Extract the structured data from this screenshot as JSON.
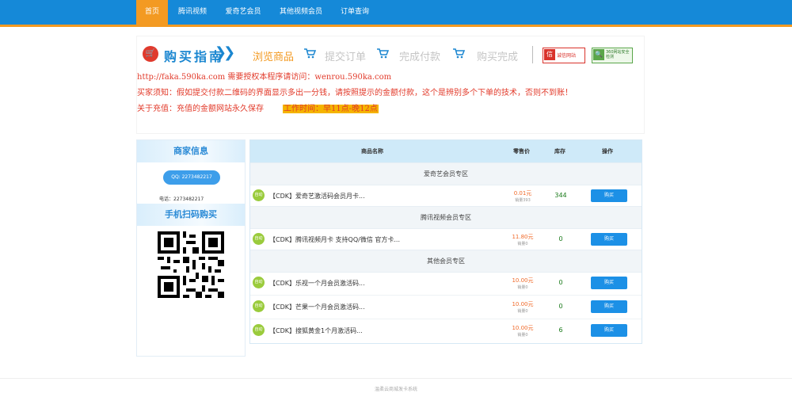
{
  "nav": {
    "items": [
      {
        "label": "首页",
        "active": true
      },
      {
        "label": "腾讯视频",
        "active": false
      },
      {
        "label": "爱奇艺会员",
        "active": false
      },
      {
        "label": "其他视频会员",
        "active": false
      },
      {
        "label": "订单查询",
        "active": false
      }
    ],
    "colors": {
      "bar": "#1589d8",
      "accent": "#f39a22"
    }
  },
  "guide": {
    "title": "购买指南",
    "steps": [
      "浏览商品",
      "提交订单",
      "完成付款",
      "购买完成"
    ],
    "badge_trust": "诚信网站",
    "badge_safe": "360网站安全检测",
    "lines": [
      "http://faka.590ka.com  需要授权本程序请访问：wenrou.590ka.com",
      "买家须知：假如提交付款二维码的界面显示多出一分钱，请按照提示的金额付款，这个是辨别多个下单的技术，否则不到账！",
      "关于充值：充值的金额网站永久保存"
    ],
    "hours": "工作时间：早11点-晚12点"
  },
  "sidebar": {
    "merchant_title": "商家信息",
    "qq_label": "QQ: 2273482217",
    "phone": "电话：2273482217",
    "qr_title": "手机扫码购买"
  },
  "table": {
    "headers": {
      "name": "商品名称",
      "price": "零售价",
      "stock": "库存",
      "action": "操作"
    },
    "sections": [
      {
        "title": "爱奇艺会员专区",
        "items": [
          {
            "tag": "自动",
            "name": "【CDK】爱奇艺激活码会员月卡...",
            "price": "0.01元",
            "sold": "销量393",
            "stock": "344",
            "buy": "购买"
          }
        ]
      },
      {
        "title": "腾讯视频会员专区",
        "items": [
          {
            "tag": "自动",
            "name": "【CDK】腾讯视频月卡 支持QQ/微信 官方卡...",
            "price": "11.80元",
            "sold": "销量0",
            "stock": "0",
            "buy": "购买"
          }
        ]
      },
      {
        "title": "其他会员专区",
        "items": [
          {
            "tag": "自动",
            "name": "【CDK】乐视一个月会员激活码...",
            "price": "10.00元",
            "sold": "销量0",
            "stock": "0",
            "buy": "购买"
          },
          {
            "tag": "自动",
            "name": "【CDK】芒果一个月会员激活码...",
            "price": "10.00元",
            "sold": "销量0",
            "stock": "0",
            "buy": "购买"
          },
          {
            "tag": "自动",
            "name": "【CDK】搜狐黄金1个月激活码...",
            "price": "10.00元",
            "sold": "销量0",
            "stock": "6",
            "buy": "购买"
          }
        ]
      }
    ]
  },
  "footer": "温柔云商城发卡系统"
}
